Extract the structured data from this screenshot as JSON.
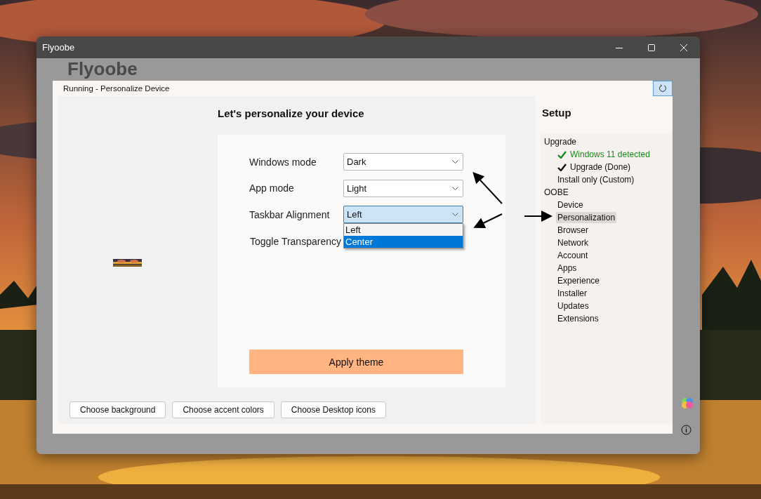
{
  "window": {
    "title": "Flyoobe"
  },
  "app_heading": "Flyoobe",
  "dialog": {
    "status": "Running - Personalize Device",
    "heading": "Let's personalize your device",
    "settings": [
      {
        "kind": "dropdown",
        "label": "Windows mode",
        "value": "Dark",
        "expanded": false
      },
      {
        "kind": "dropdown",
        "label": "App mode",
        "value": "Light",
        "expanded": false
      },
      {
        "kind": "dropdown",
        "label": "Taskbar Alignment",
        "value": "Left",
        "expanded": true,
        "options": [
          {
            "label": "Left",
            "highlighted": false
          },
          {
            "label": "Center",
            "highlighted": true
          }
        ]
      },
      {
        "kind": "label",
        "label": "Toggle Transparency"
      }
    ],
    "apply_button": "Apply theme",
    "bottom_buttons": [
      "Choose background",
      "Choose accent colors",
      "Choose Desktop icons"
    ]
  },
  "sidebar": {
    "title": "Setup",
    "items": [
      {
        "label": "Upgrade",
        "selected": false,
        "children": [
          {
            "label": "Windows 11 detected",
            "kind": "detected",
            "selected": false
          },
          {
            "label": "Upgrade (Done)",
            "kind": "done",
            "selected": false
          },
          {
            "label": "Install only (Custom)",
            "kind": "plain",
            "selected": false
          }
        ]
      },
      {
        "label": "OOBE",
        "selected": false,
        "children": [
          {
            "label": "Device",
            "kind": "plain",
            "selected": false
          },
          {
            "label": "Personalization",
            "kind": "plain",
            "selected": true
          },
          {
            "label": "Browser",
            "kind": "plain",
            "selected": false
          },
          {
            "label": "Network",
            "kind": "plain",
            "selected": false
          },
          {
            "label": "Account",
            "kind": "plain",
            "selected": false
          },
          {
            "label": "Apps",
            "kind": "plain",
            "selected": false
          },
          {
            "label": "Experience",
            "kind": "plain",
            "selected": false
          },
          {
            "label": "Installer",
            "kind": "plain",
            "selected": false
          },
          {
            "label": "Updates",
            "kind": "plain",
            "selected": false
          },
          {
            "label": "Extensions",
            "kind": "plain",
            "selected": false
          }
        ]
      }
    ]
  }
}
